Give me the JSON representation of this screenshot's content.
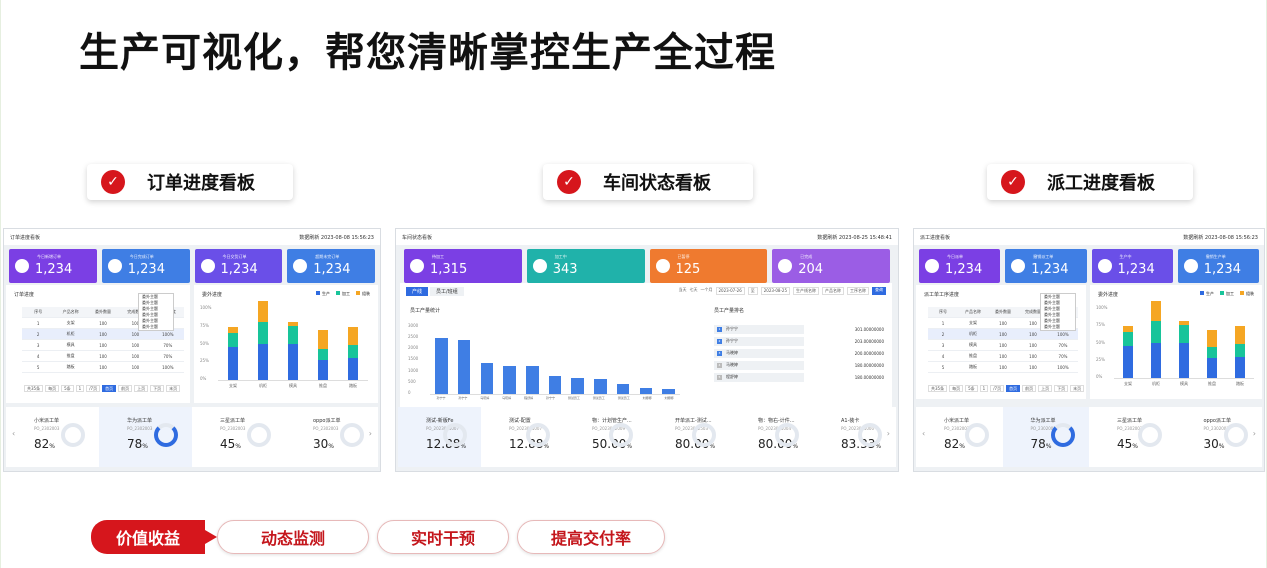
{
  "headline": "生产可视化，帮您清晰掌控生产全过程",
  "sections": [
    {
      "label": "订单进度看板"
    },
    {
      "label": "车间状态看板"
    },
    {
      "label": "派工进度看板"
    }
  ],
  "panels": {
    "order": {
      "title": "订单进度看板",
      "time": "数据刷新 2023-08-08 15:56:23",
      "kpis": [
        {
          "label": "今日新增订单",
          "value": "1,234",
          "color": "#7b3fe4"
        },
        {
          "label": "今日完成订单",
          "value": "1,234",
          "color": "#3f7ee4"
        },
        {
          "label": "今日交货订单",
          "value": "1,234",
          "color": "#6a4fe8"
        },
        {
          "label": "超期未完订单",
          "value": "1,234",
          "color": "#3f7ee4"
        }
      ],
      "table_title": "订单进度",
      "chart_title": "委外进度",
      "columns": [
        "序号",
        "产品名称",
        "委外数量",
        "完成数量",
        "委外进度"
      ],
      "rows": [
        [
          "1",
          "支架",
          "100",
          "100",
          "100%"
        ],
        [
          "2",
          "机柜",
          "100",
          "100",
          "100%"
        ],
        [
          "3",
          "模具",
          "100",
          "100",
          "70%"
        ],
        [
          "4",
          "推盘",
          "100",
          "100",
          "70%"
        ],
        [
          "5",
          "踏板",
          "100",
          "100",
          "100%"
        ]
      ],
      "dropdown": [
        "委外主题",
        "委外主题",
        "委外主题",
        "委外主题",
        "委外主题",
        "委外主题"
      ],
      "pager": [
        "共35条",
        "每页",
        "5条",
        "1",
        "/7页",
        "首页",
        "前页",
        "上页",
        "下页",
        "末页"
      ],
      "legend": [
        "生产",
        "加工",
        "组装"
      ],
      "x_labels": [
        "支架",
        "机柜",
        "模具",
        "推盘",
        "踏板"
      ],
      "y_labels": [
        "100%",
        "75%",
        "50%",
        "25%",
        "0%"
      ],
      "gauges": [
        {
          "name": "小米派工单",
          "sub": "PO_2302003",
          "value": "82",
          "unit": "%"
        },
        {
          "name": "华为派工单",
          "sub": "PO_2302003",
          "value": "78",
          "unit": "%"
        },
        {
          "name": "三星派工单",
          "sub": "PO_2302003",
          "value": "45",
          "unit": "%"
        },
        {
          "name": "oppo派工单",
          "sub": "PO_2302003",
          "value": "30",
          "unit": "%"
        }
      ]
    },
    "workshop": {
      "title": "车间状态看板",
      "time": "数据刷新 2023-08-25 15:48:41",
      "kpis": [
        {
          "label": "待加工",
          "value": "1,315",
          "color": "#7b3fe4"
        },
        {
          "label": "加工中",
          "value": "343",
          "color": "#20b2aa"
        },
        {
          "label": "已暂停",
          "value": "125",
          "color": "#ef7a2f"
        },
        {
          "label": "已完成",
          "value": "204",
          "color": "#9b5de5"
        }
      ],
      "tabs": [
        "产线",
        "员工/班组"
      ],
      "filters": [
        "当天",
        "七天",
        "一个月",
        "2023-07-26",
        "至",
        "2023-08-25",
        "生产线名称",
        "产品名称",
        "工序名称",
        "查询"
      ],
      "chart_title": "员工产量统计",
      "rank_title": "员工产量排名",
      "y_labels": [
        "3000",
        "2500",
        "2000",
        "1500",
        "1000",
        "500",
        "0"
      ],
      "x_labels": [
        "孙宁宁",
        "孙宁宁",
        "马晓婷",
        "马晓婷",
        "程舒婷",
        "孙宁宁",
        "测试员工",
        "测试员工",
        "测试员工",
        "刘娜娜",
        "刘娜娜"
      ],
      "ranking": [
        {
          "name": "孙宁宁",
          "value": "301.00000000"
        },
        {
          "name": "孙宁宁",
          "value": "203.00000000"
        },
        {
          "name": "马晓婷",
          "value": "200.00000000"
        },
        {
          "name": "马晓婷",
          "value": "180.00000000"
        },
        {
          "name": "程舒婷",
          "value": "180.00000000"
        }
      ],
      "gauges": [
        {
          "name": "测试-新版Fe",
          "sub": "PO_2023081007",
          "value": "12.88",
          "unit": "%"
        },
        {
          "name": "测试-配置",
          "sub": "PO_2023081007",
          "value": "12.88",
          "unit": "%"
        },
        {
          "name": "物：计划管生产...",
          "sub": "PO_2023082009",
          "value": "50.00",
          "unit": "%"
        },
        {
          "name": "开单派工-测试...",
          "sub": "PO_2023082503",
          "value": "80.00",
          "unit": "%"
        },
        {
          "name": "物：物右-计件...",
          "sub": "PO_2023081004",
          "value": "80.00",
          "unit": "%"
        },
        {
          "name": "A1-装卡",
          "sub": "PO_2023081000",
          "value": "83.33",
          "unit": "%"
        }
      ]
    },
    "dispatch": {
      "title": "派工进度看板",
      "time": "数据刷新 2023-08-08 15:56:23",
      "kpis": [
        {
          "label": "今日派单",
          "value": "1,234",
          "color": "#7b3fe4"
        },
        {
          "label": "撤销派工单",
          "value": "1,234",
          "color": "#3f7ee4"
        },
        {
          "label": "生产中",
          "value": "1,234",
          "color": "#6a4fe8"
        },
        {
          "label": "撤销生产单",
          "value": "1,234",
          "color": "#3f7ee4"
        }
      ],
      "table_title": "派工单工序进度",
      "chart_title": "委外进度",
      "columns": [
        "序号",
        "产品名称",
        "委外数量",
        "完成数量",
        "委外进度"
      ],
      "rows": [
        [
          "1",
          "支架",
          "100",
          "100",
          "100%"
        ],
        [
          "2",
          "机柜",
          "100",
          "100",
          "100%"
        ],
        [
          "3",
          "模具",
          "100",
          "100",
          "70%"
        ],
        [
          "4",
          "推盘",
          "100",
          "100",
          "70%"
        ],
        [
          "5",
          "踏板",
          "100",
          "100",
          "100%"
        ]
      ],
      "dropdown": [
        "委外主题",
        "委外主题",
        "委外主题",
        "委外主题",
        "委外主题",
        "委外主题"
      ],
      "pager": [
        "共35条",
        "每页",
        "5条",
        "1",
        "/7页",
        "首页",
        "前页",
        "上页",
        "下页",
        "末页"
      ],
      "legend": [
        "生产",
        "加工",
        "组装"
      ],
      "x_labels": [
        "支架",
        "机柜",
        "模具",
        "推盘",
        "踏板"
      ],
      "y_labels": [
        "100%",
        "75%",
        "50%",
        "25%",
        "0%"
      ],
      "gauges": [
        {
          "name": "小米派工单",
          "sub": "PO_2302003",
          "value": "82",
          "unit": "%"
        },
        {
          "name": "华为派工单",
          "sub": "PO_2302003",
          "value": "78",
          "unit": "%"
        },
        {
          "name": "三星派工单",
          "sub": "PO_2302003",
          "value": "45",
          "unit": "%"
        },
        {
          "name": "oppo派工单",
          "sub": "PO_2302003",
          "value": "30",
          "unit": "%"
        }
      ]
    }
  },
  "chart_data": [
    {
      "type": "bar",
      "stacked": true,
      "categories": [
        "支架",
        "机柜",
        "模具",
        "推盘",
        "踏板"
      ],
      "series": [
        {
          "name": "生产",
          "values": [
            45,
            50,
            50,
            28,
            30
          ],
          "color": "#2f6be0"
        },
        {
          "name": "加工",
          "values": [
            20,
            30,
            24,
            15,
            18
          ],
          "color": "#18c49a"
        },
        {
          "name": "组装",
          "values": [
            8,
            28,
            6,
            25,
            25
          ],
          "color": "#f5a623"
        }
      ],
      "ylim": [
        0,
        100
      ]
    },
    {
      "type": "bar",
      "categories": [
        "孙宁宁",
        "孙宁宁",
        "马晓婷",
        "马晓婷",
        "程舒婷",
        "孙宁宁",
        "测试员工",
        "测试员工",
        "测试员工",
        "刘娜娜",
        "刘娜娜"
      ],
      "values": [
        2450,
        2350,
        1350,
        1200,
        1200,
        800,
        700,
        650,
        450,
        250,
        200
      ],
      "ylim": [
        0,
        3000
      ],
      "color": "#3f7ee4"
    }
  ],
  "value_label": "价值收益",
  "value_tags": [
    "动态监测",
    "实时干预",
    "提高交付率"
  ],
  "colors": {
    "accent": "#d6161c",
    "bar_blue": "#2f6be0",
    "green": "#18c49a",
    "orange": "#f5a623"
  }
}
